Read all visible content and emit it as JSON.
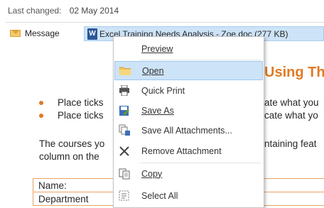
{
  "header": {
    "last_changed_label": "Last changed:",
    "last_changed_value": "02 May 2014"
  },
  "tabs": {
    "message_label": "Message",
    "attachment_label": "Excel Training Needs Analysis - Zoe.doc (277 KB)",
    "attachment_icon": "W"
  },
  "doc": {
    "heading": "Using Th",
    "bullet1": "Place ticks",
    "bullet2": "Place ticks",
    "bullet1_tail": "ate what you",
    "bullet2_tail": "cate what yo",
    "para_line1": "The courses yo",
    "para_line2": "column on the",
    "para_tail": "ntaining feat",
    "table_row1": "Name:",
    "table_row2": "Department"
  },
  "menu": {
    "items": [
      {
        "label": "Preview",
        "icon": "none"
      },
      {
        "label": "Open",
        "icon": "folder-icon"
      },
      {
        "label": "Quick Print",
        "icon": "printer-icon"
      },
      {
        "label": "Save As",
        "icon": "save-as-icon"
      },
      {
        "label": "Save All Attachments...",
        "icon": "save-all-icon"
      },
      {
        "label": "Remove Attachment",
        "icon": "remove-x-icon"
      },
      {
        "label": "Copy",
        "icon": "copy-icon"
      },
      {
        "label": "Select All",
        "icon": "select-all-icon"
      }
    ]
  },
  "colors": {
    "accent_orange": "#e07a24",
    "highlight_blue": "#cde3f7"
  }
}
